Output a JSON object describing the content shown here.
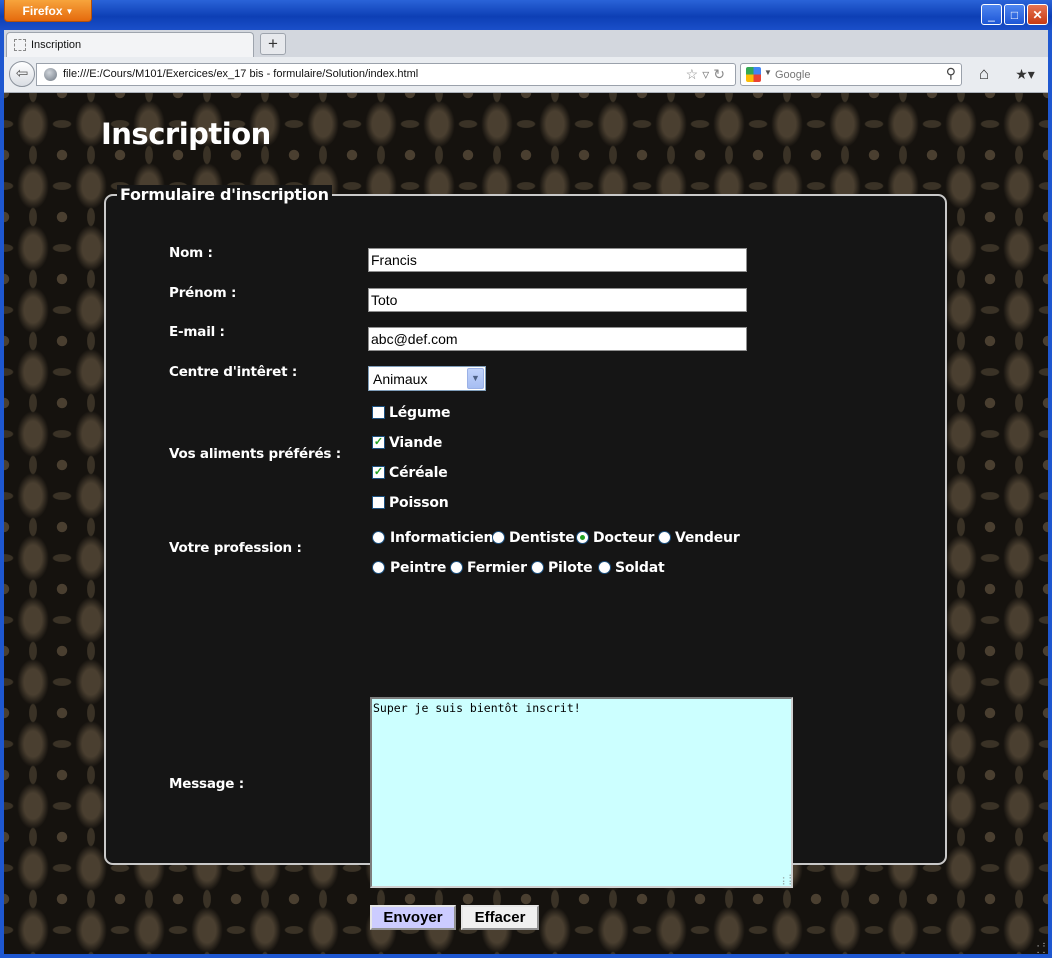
{
  "browser": {
    "menu_button": "Firefox",
    "tab_title": "Inscription",
    "new_tab": "+",
    "url": "file:///E:/Cours/M101/Exercices/ex_17 bis - formulaire/Solution/index.html",
    "search_placeholder": "Google",
    "window_buttons": [
      "minimize",
      "maximize",
      "close"
    ]
  },
  "page": {
    "title": "Inscription",
    "legend": "Formulaire d'inscription"
  },
  "form": {
    "nom": {
      "label": "Nom :",
      "value": "Francis"
    },
    "prenom": {
      "label": "Prénom :",
      "value": "Toto"
    },
    "email": {
      "label": "E-mail :",
      "value": "abc@def.com"
    },
    "interet": {
      "label": "Centre d'intêret :",
      "selected": "Animaux"
    },
    "aliments": {
      "label": "Vos aliments préférés :",
      "options": [
        {
          "label": "Légume",
          "checked": false
        },
        {
          "label": "Viande",
          "checked": true
        },
        {
          "label": "Céréale",
          "checked": true
        },
        {
          "label": "Poisson",
          "checked": false
        }
      ]
    },
    "profession": {
      "label": "Votre profession :",
      "options": [
        {
          "label": "Informaticien",
          "selected": false
        },
        {
          "label": "Dentiste",
          "selected": false
        },
        {
          "label": "Docteur",
          "selected": true
        },
        {
          "label": "Vendeur",
          "selected": false
        },
        {
          "label": "Peintre",
          "selected": false
        },
        {
          "label": "Fermier",
          "selected": false
        },
        {
          "label": "Pilote",
          "selected": false
        },
        {
          "label": "Soldat",
          "selected": false
        }
      ]
    },
    "message": {
      "label": "Message :",
      "value": "Super je suis bientôt inscrit!"
    },
    "submit_label": "Envoyer",
    "reset_label": "Effacer"
  },
  "colors": {
    "textarea_bg": "#ccffff",
    "submit_bg": "#ccccff",
    "fieldset_bg": "#151515",
    "titlebar": "#0d3fb5",
    "firefox_button": "#e56a0d"
  }
}
